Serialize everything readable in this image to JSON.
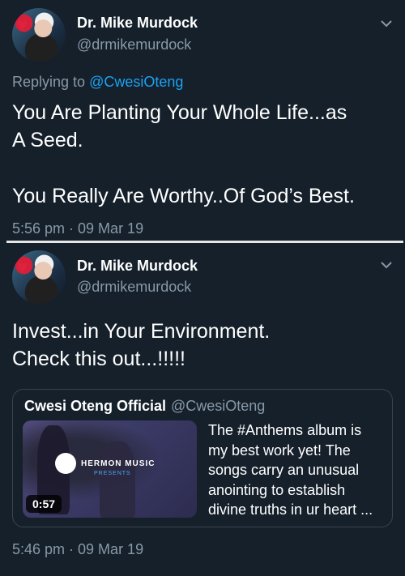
{
  "tweet1": {
    "display_name": "Dr. Mike Murdock",
    "handle": "@drmikemurdock",
    "replying_label": "Replying to",
    "replying_to": "@CwesiOteng",
    "body_line1": "You Are Planting Your Whole Life...as",
    "body_line2": "A Seed.",
    "body_line3": "You Really Are Worthy..Of God’s Best.",
    "timestamp": "5:56 pm · 09 Mar 19"
  },
  "tweet2": {
    "display_name": "Dr. Mike Murdock",
    "handle": "@drmikemurdock",
    "body_line1": "Invest...in Your Environment.",
    "body_line2": "Check this out...!!!!!",
    "timestamp": "5:46 pm · 09 Mar 19",
    "quote": {
      "display_name": "Cwesi Oteng Official",
      "handle": "@CwesiOteng",
      "media_logo_text": "HERMON MUSIC",
      "media_logo_sub": "PRESENTS",
      "media_duration": "0:57",
      "text_lines": [
        "The #Anthems album is",
        "my best work yet! The",
        "songs carry an unusual",
        "anointing to establish",
        "divine truths in ur heart ..."
      ]
    }
  },
  "colors": {
    "background": "#15202b",
    "secondary_text": "#8899a6",
    "link": "#1da1f2",
    "border": "#38444d"
  },
  "icons": {
    "caret": "chevron-down-icon"
  }
}
